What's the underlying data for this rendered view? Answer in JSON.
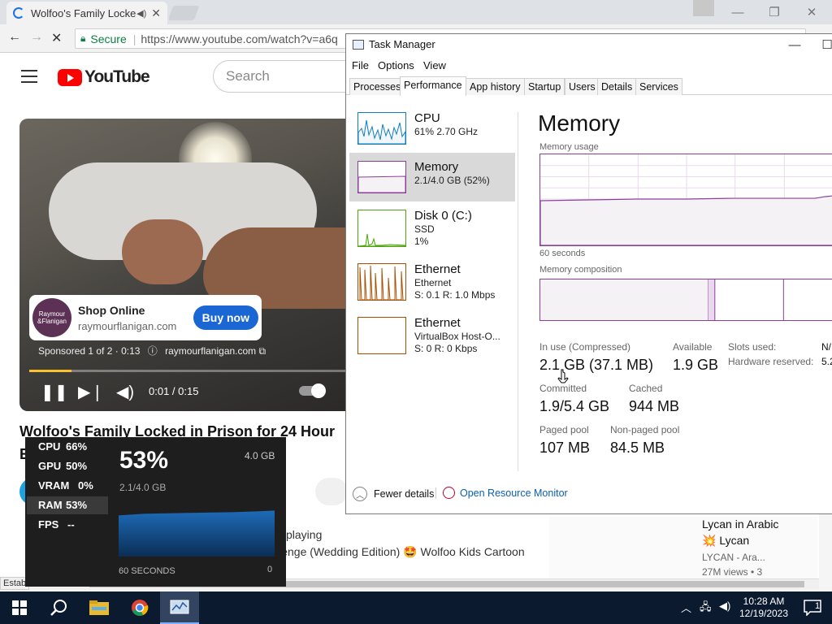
{
  "browser": {
    "tab_title": "Wolfoo's Family Locke",
    "secure_label": "Secure",
    "url": "https://www.youtube.com/watch?v=a6q"
  },
  "youtube": {
    "logo_text": "YouTube",
    "search_placeholder": "Search",
    "ad": {
      "logo_text": "Raymour & Flanigan FURNITURE MATTRESSES",
      "title": "Shop Online",
      "domain": "raymourflanigan.com",
      "cta": "Buy now",
      "sponsored": "Sponsored 1 of 2 · 0:13",
      "sponsored_domain": "raymourflanigan.com"
    },
    "player": {
      "time": "0:01 / 0:15",
      "progress": 0.13
    },
    "video_title_line1": "Wolfoo's Family Locked in Prison for 24 Hour",
    "video_title_line2": "E",
    "recommendation": {
      "playing": "playing",
      "title": "llenge (Wedding Edition) 🤩 Wolfoo Kids Cartoon"
    },
    "side_video": {
      "title1": "Lycan in Arabic",
      "title2": "💥 Lycan",
      "channel": "LYCAN - Ara...",
      "views": "27M views  •  3"
    },
    "status_bar": "Estab"
  },
  "game_bar": {
    "stats": [
      {
        "label": "CPU",
        "value": "66%"
      },
      {
        "label": "GPU",
        "value": "50%"
      },
      {
        "label": "VRAM",
        "value": "0%"
      },
      {
        "label": "RAM",
        "value": "53%"
      },
      {
        "label": "FPS",
        "value": "--"
      }
    ],
    "big_value": "53%",
    "total": "4.0 GB",
    "used": "2.1/4.0 GB",
    "axis_left": "60 SECONDS",
    "axis_right": "0",
    "usage_fraction": 0.53
  },
  "task_manager": {
    "title": "Task Manager",
    "menu": [
      "File",
      "Options",
      "View"
    ],
    "tabs": [
      "Processes",
      "Performance",
      "App history",
      "Startup",
      "Users",
      "Details",
      "Services"
    ],
    "active_tab": "Performance",
    "nav": [
      {
        "name": "CPU",
        "line2": "61%  2.70 GHz",
        "line3": ""
      },
      {
        "name": "Memory",
        "line2": "2.1/4.0 GB (52%)",
        "line3": ""
      },
      {
        "name": "Disk 0 (C:)",
        "line2": "SSD",
        "line3": "1%"
      },
      {
        "name": "Ethernet",
        "line2": "Ethernet",
        "line3": "S: 0.1  R: 1.0 Mbps"
      },
      {
        "name": "Ethernet",
        "line2": "VirtualBox Host-O...",
        "line3": "S: 0  R: 0 Kbps"
      }
    ],
    "memory": {
      "heading": "Memory",
      "usage_label": "Memory usage",
      "seconds_label": "60 seconds",
      "composition_label": "Memory composition",
      "in_use_label": "In use (Compressed)",
      "in_use_value": "2.1 GB (37.1 MB)",
      "available_label": "Available",
      "available_value": "1.9 GB",
      "slots_label": "Slots used:",
      "slots_value": "N/",
      "hw_reserved_label": "Hardware reserved:",
      "hw_reserved_value": "5.2",
      "committed_label": "Committed",
      "committed_value": "1.9/5.4 GB",
      "cached_label": "Cached",
      "cached_value": "944 MB",
      "paged_label": "Paged pool",
      "paged_value": "107 MB",
      "nonpaged_label": "Non-paged pool",
      "nonpaged_value": "84.5 MB"
    },
    "fewer_details": "Fewer details",
    "open_resource_monitor": "Open Resource Monitor"
  },
  "taskbar": {
    "time": "10:28 AM",
    "date": "12/19/2023",
    "notification_count": "1"
  },
  "colors": {
    "memory_purple": "#8b3f9b",
    "cpu_blue": "#117dbb",
    "disk_green": "#4da60c",
    "ethernet_orange": "#a74f01",
    "youtube_red": "#ff0000",
    "buy_now_blue": "#1a66d2"
  }
}
